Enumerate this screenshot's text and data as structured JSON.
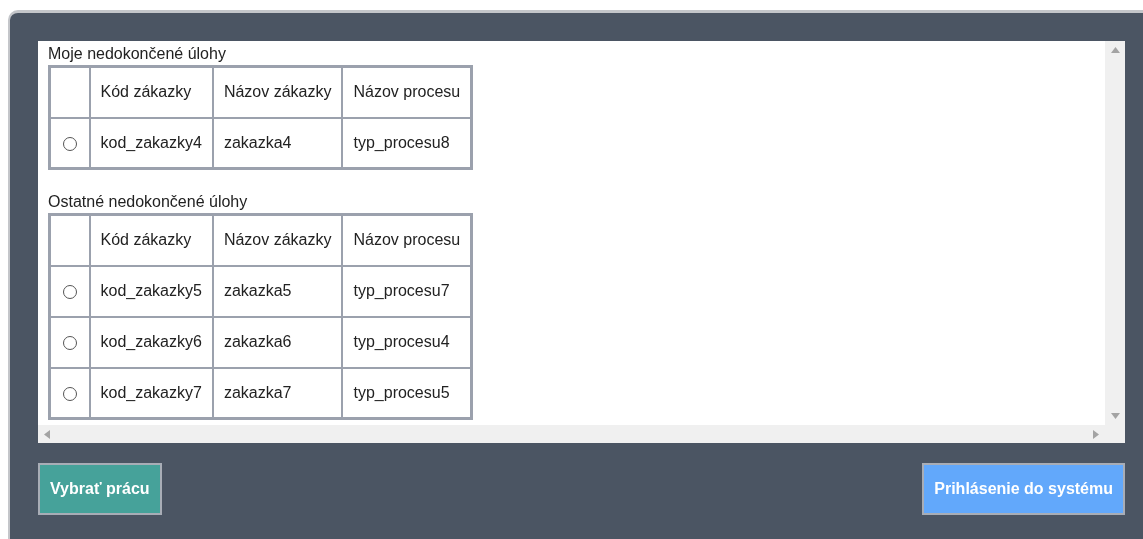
{
  "sections": [
    {
      "title": "Moje nedokončené úlohy",
      "columns": [
        "Kód zákazky",
        "Názov zákazky",
        "Názov procesu"
      ],
      "rows": [
        {
          "selected": false,
          "cells": [
            "kod_zakazky4",
            "zakazka4",
            "typ_procesu8"
          ]
        }
      ]
    },
    {
      "title": "Ostatné nedokončené úlohy",
      "columns": [
        "Kód zákazky",
        "Názov zákazky",
        "Názov procesu"
      ],
      "rows": [
        {
          "selected": false,
          "cells": [
            "kod_zakazky5",
            "zakazka5",
            "typ_procesu7"
          ]
        },
        {
          "selected": false,
          "cells": [
            "kod_zakazky6",
            "zakazka6",
            "typ_procesu4"
          ]
        },
        {
          "selected": false,
          "cells": [
            "kod_zakazky7",
            "zakazka7",
            "typ_procesu5"
          ]
        }
      ]
    }
  ],
  "buttons": [
    {
      "label": "Vybrať prácu",
      "kind": "select"
    },
    {
      "label": "Prihlásenie do systému",
      "kind": "login"
    }
  ]
}
